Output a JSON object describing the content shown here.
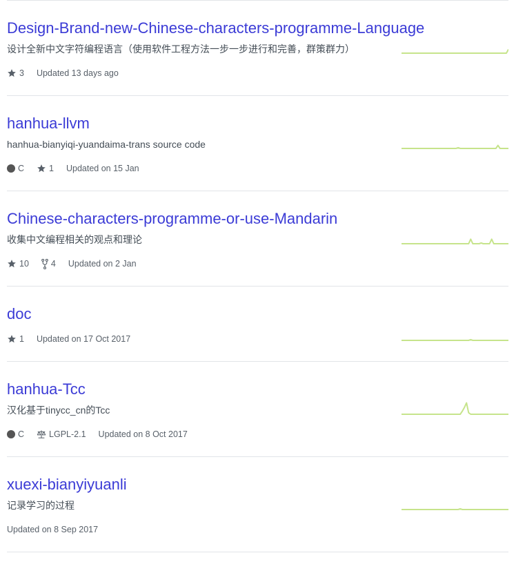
{
  "repos": [
    {
      "name": "Design-Brand-new-Chinese-characters-programme-Language",
      "description": "设计全新中文字符编程语言（使用软件工程方法一步一步进行和完善，群策群力）",
      "stars": "3",
      "updated": "Updated 13 days ago",
      "spark": [
        0,
        0,
        0,
        0,
        0,
        0,
        0,
        0,
        0,
        0,
        0,
        0,
        0,
        0,
        0,
        0,
        0,
        0,
        0,
        0,
        0,
        0,
        0,
        0,
        0,
        0,
        0,
        0,
        0,
        0,
        0,
        0,
        0,
        0,
        0,
        0,
        0,
        0,
        0,
        0,
        0,
        0,
        0,
        0,
        0,
        0,
        0,
        0,
        0,
        0,
        0,
        5
      ]
    },
    {
      "name": "hanhua-llvm",
      "description": "hanhua-bianyiqi-yuandaima-trans source code",
      "language": "C",
      "stars": "1",
      "updated": "Updated on 15 Jan",
      "spark": [
        0,
        0,
        0,
        0,
        0,
        0,
        0,
        0,
        0,
        0,
        0,
        0,
        0,
        0,
        0,
        0,
        0,
        0,
        0,
        0,
        0,
        0,
        0,
        0,
        0,
        0,
        0,
        1,
        0,
        0,
        0,
        0,
        0,
        0,
        0,
        0,
        0,
        0,
        0,
        0,
        0,
        0,
        0,
        0,
        0,
        0,
        4,
        0,
        0,
        0,
        0,
        0
      ]
    },
    {
      "name": "Chinese-characters-programme-or-use-Mandarin",
      "description": "收集中文编程相关的观点和理论",
      "stars": "10",
      "forks": "4",
      "updated": "Updated on 2 Jan",
      "spark": [
        0,
        0,
        0,
        0,
        0,
        0,
        0,
        0,
        0,
        0,
        0,
        0,
        0,
        0,
        0,
        0,
        0,
        0,
        0,
        0,
        0,
        0,
        0,
        0,
        0,
        0,
        0,
        0,
        0,
        0,
        0,
        0,
        0,
        6,
        0,
        0,
        0,
        0,
        1,
        0,
        0,
        0,
        0,
        6,
        0,
        0,
        0,
        0,
        0,
        0,
        0,
        0
      ]
    },
    {
      "name": "doc",
      "stars": "1",
      "updated": "Updated on 17 Oct 2017",
      "spark": [
        0,
        0,
        0,
        0,
        0,
        0,
        0,
        0,
        0,
        0,
        0,
        0,
        0,
        0,
        0,
        0,
        0,
        0,
        0,
        0,
        0,
        0,
        0,
        0,
        0,
        0,
        0,
        0,
        0,
        0,
        0,
        0,
        0,
        1,
        0,
        0,
        0,
        0,
        0,
        0,
        0,
        0,
        0,
        0,
        0,
        0,
        0,
        0,
        0,
        0,
        0,
        0
      ]
    },
    {
      "name": "hanhua-Tcc",
      "description": "汉化基于tinycc_cn的Tcc",
      "language": "C",
      "license": "LGPL-2.1",
      "updated": "Updated on 8 Oct 2017",
      "spark": [
        0,
        0,
        0,
        0,
        0,
        0,
        0,
        0,
        0,
        0,
        0,
        0,
        0,
        0,
        0,
        0,
        0,
        0,
        0,
        0,
        0,
        0,
        0,
        0,
        0,
        0,
        0,
        0,
        0,
        4,
        9,
        15,
        2,
        0,
        0,
        0,
        0,
        0,
        0,
        0,
        0,
        0,
        0,
        0,
        0,
        0,
        0,
        0,
        0,
        0,
        0,
        0
      ]
    },
    {
      "name": "xuexi-bianyiyuanli",
      "description": "记录学习的过程",
      "updated": "Updated on 8 Sep 2017",
      "spark": [
        0,
        0,
        0,
        0,
        0,
        0,
        0,
        0,
        0,
        0,
        0,
        0,
        0,
        0,
        0,
        0,
        0,
        0,
        0,
        0,
        0,
        0,
        0,
        0,
        0,
        0,
        0,
        0,
        1,
        0,
        0,
        0,
        0,
        0,
        0,
        0,
        0,
        0,
        0,
        0,
        0,
        0,
        0,
        0,
        0,
        0,
        0,
        0,
        0,
        0,
        0,
        0
      ]
    }
  ],
  "colors": {
    "link": "#3b3bd6",
    "spark": "#c6e48b",
    "lang_c": "#555555"
  }
}
